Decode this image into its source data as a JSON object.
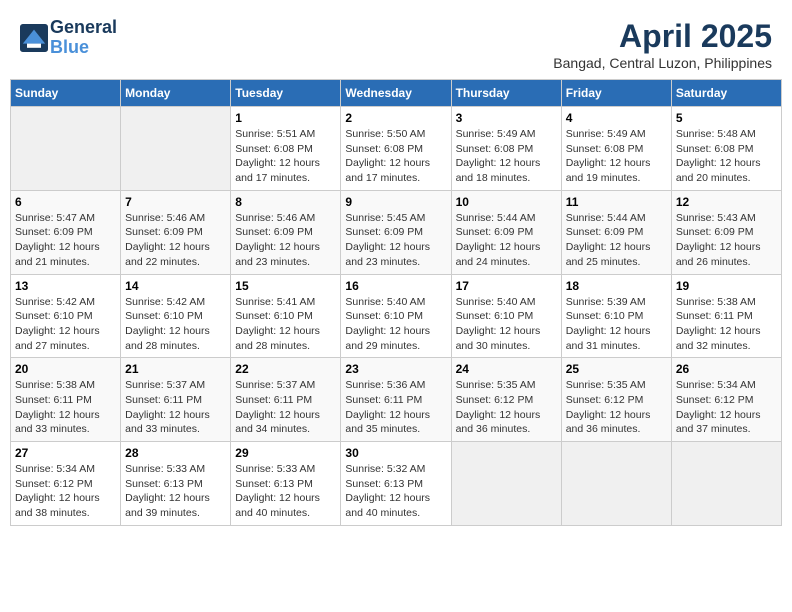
{
  "logo": {
    "line1": "General",
    "line2": "Blue"
  },
  "title": "April 2025",
  "subtitle": "Bangad, Central Luzon, Philippines",
  "weekdays": [
    "Sunday",
    "Monday",
    "Tuesday",
    "Wednesday",
    "Thursday",
    "Friday",
    "Saturday"
  ],
  "weeks": [
    [
      {
        "day": "",
        "info": ""
      },
      {
        "day": "",
        "info": ""
      },
      {
        "day": "1",
        "info": "Sunrise: 5:51 AM\nSunset: 6:08 PM\nDaylight: 12 hours\nand 17 minutes."
      },
      {
        "day": "2",
        "info": "Sunrise: 5:50 AM\nSunset: 6:08 PM\nDaylight: 12 hours\nand 17 minutes."
      },
      {
        "day": "3",
        "info": "Sunrise: 5:49 AM\nSunset: 6:08 PM\nDaylight: 12 hours\nand 18 minutes."
      },
      {
        "day": "4",
        "info": "Sunrise: 5:49 AM\nSunset: 6:08 PM\nDaylight: 12 hours\nand 19 minutes."
      },
      {
        "day": "5",
        "info": "Sunrise: 5:48 AM\nSunset: 6:08 PM\nDaylight: 12 hours\nand 20 minutes."
      }
    ],
    [
      {
        "day": "6",
        "info": "Sunrise: 5:47 AM\nSunset: 6:09 PM\nDaylight: 12 hours\nand 21 minutes."
      },
      {
        "day": "7",
        "info": "Sunrise: 5:46 AM\nSunset: 6:09 PM\nDaylight: 12 hours\nand 22 minutes."
      },
      {
        "day": "8",
        "info": "Sunrise: 5:46 AM\nSunset: 6:09 PM\nDaylight: 12 hours\nand 23 minutes."
      },
      {
        "day": "9",
        "info": "Sunrise: 5:45 AM\nSunset: 6:09 PM\nDaylight: 12 hours\nand 23 minutes."
      },
      {
        "day": "10",
        "info": "Sunrise: 5:44 AM\nSunset: 6:09 PM\nDaylight: 12 hours\nand 24 minutes."
      },
      {
        "day": "11",
        "info": "Sunrise: 5:44 AM\nSunset: 6:09 PM\nDaylight: 12 hours\nand 25 minutes."
      },
      {
        "day": "12",
        "info": "Sunrise: 5:43 AM\nSunset: 6:09 PM\nDaylight: 12 hours\nand 26 minutes."
      }
    ],
    [
      {
        "day": "13",
        "info": "Sunrise: 5:42 AM\nSunset: 6:10 PM\nDaylight: 12 hours\nand 27 minutes."
      },
      {
        "day": "14",
        "info": "Sunrise: 5:42 AM\nSunset: 6:10 PM\nDaylight: 12 hours\nand 28 minutes."
      },
      {
        "day": "15",
        "info": "Sunrise: 5:41 AM\nSunset: 6:10 PM\nDaylight: 12 hours\nand 28 minutes."
      },
      {
        "day": "16",
        "info": "Sunrise: 5:40 AM\nSunset: 6:10 PM\nDaylight: 12 hours\nand 29 minutes."
      },
      {
        "day": "17",
        "info": "Sunrise: 5:40 AM\nSunset: 6:10 PM\nDaylight: 12 hours\nand 30 minutes."
      },
      {
        "day": "18",
        "info": "Sunrise: 5:39 AM\nSunset: 6:10 PM\nDaylight: 12 hours\nand 31 minutes."
      },
      {
        "day": "19",
        "info": "Sunrise: 5:38 AM\nSunset: 6:11 PM\nDaylight: 12 hours\nand 32 minutes."
      }
    ],
    [
      {
        "day": "20",
        "info": "Sunrise: 5:38 AM\nSunset: 6:11 PM\nDaylight: 12 hours\nand 33 minutes."
      },
      {
        "day": "21",
        "info": "Sunrise: 5:37 AM\nSunset: 6:11 PM\nDaylight: 12 hours\nand 33 minutes."
      },
      {
        "day": "22",
        "info": "Sunrise: 5:37 AM\nSunset: 6:11 PM\nDaylight: 12 hours\nand 34 minutes."
      },
      {
        "day": "23",
        "info": "Sunrise: 5:36 AM\nSunset: 6:11 PM\nDaylight: 12 hours\nand 35 minutes."
      },
      {
        "day": "24",
        "info": "Sunrise: 5:35 AM\nSunset: 6:12 PM\nDaylight: 12 hours\nand 36 minutes."
      },
      {
        "day": "25",
        "info": "Sunrise: 5:35 AM\nSunset: 6:12 PM\nDaylight: 12 hours\nand 36 minutes."
      },
      {
        "day": "26",
        "info": "Sunrise: 5:34 AM\nSunset: 6:12 PM\nDaylight: 12 hours\nand 37 minutes."
      }
    ],
    [
      {
        "day": "27",
        "info": "Sunrise: 5:34 AM\nSunset: 6:12 PM\nDaylight: 12 hours\nand 38 minutes."
      },
      {
        "day": "28",
        "info": "Sunrise: 5:33 AM\nSunset: 6:13 PM\nDaylight: 12 hours\nand 39 minutes."
      },
      {
        "day": "29",
        "info": "Sunrise: 5:33 AM\nSunset: 6:13 PM\nDaylight: 12 hours\nand 40 minutes."
      },
      {
        "day": "30",
        "info": "Sunrise: 5:32 AM\nSunset: 6:13 PM\nDaylight: 12 hours\nand 40 minutes."
      },
      {
        "day": "",
        "info": ""
      },
      {
        "day": "",
        "info": ""
      },
      {
        "day": "",
        "info": ""
      }
    ]
  ]
}
